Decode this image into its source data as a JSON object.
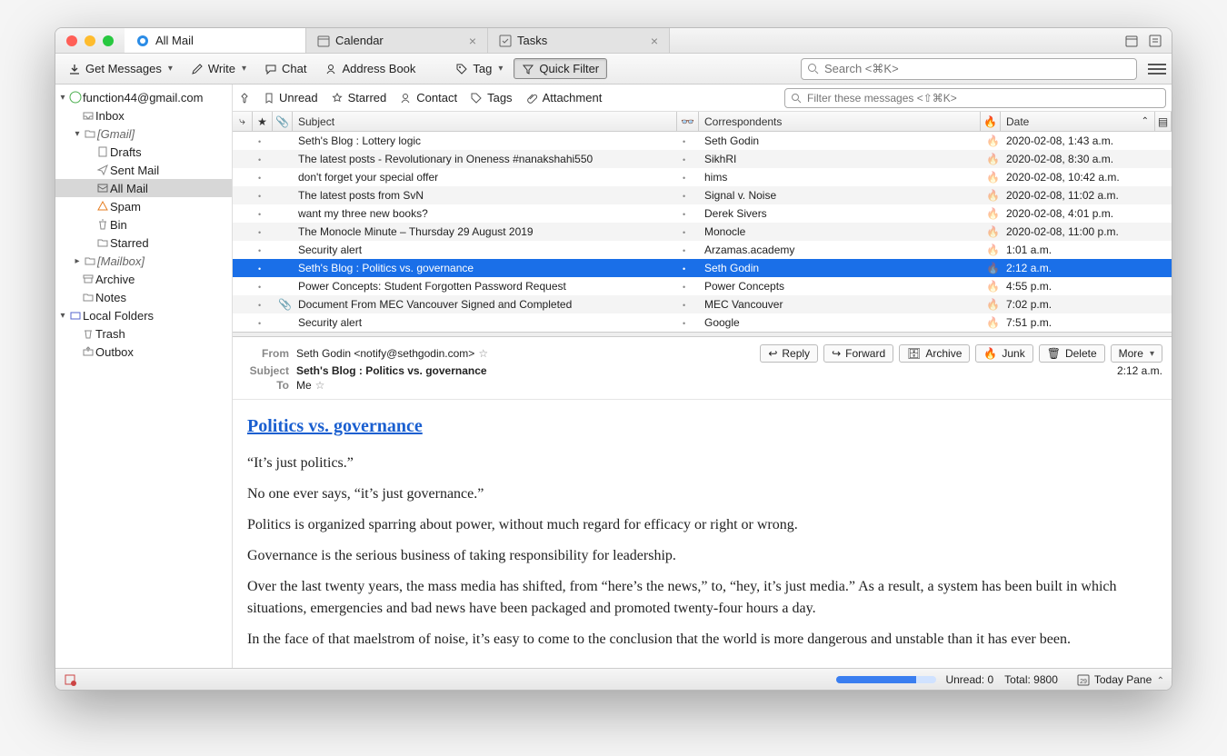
{
  "tabs": [
    {
      "label": "All Mail",
      "active": true,
      "icon": "thunderbird"
    },
    {
      "label": "Calendar",
      "active": false,
      "icon": "calendar",
      "closable": true
    },
    {
      "label": "Tasks",
      "active": false,
      "icon": "tasks",
      "closable": true
    }
  ],
  "toolbar": {
    "get_messages": "Get Messages",
    "write": "Write",
    "chat": "Chat",
    "address_book": "Address Book",
    "tag": "Tag",
    "quick_filter": "Quick Filter",
    "search_placeholder": "Search <⌘K>"
  },
  "sidebar": {
    "account": "function44@gmail.com",
    "inbox": "Inbox",
    "gmail": "[Gmail]",
    "drafts": "Drafts",
    "sent": "Sent Mail",
    "all_mail": "All Mail",
    "spam": "Spam",
    "bin": "Bin",
    "starred": "Starred",
    "mailbox": "[Mailbox]",
    "archive": "Archive",
    "notes": "Notes",
    "local_folders": "Local Folders",
    "trash": "Trash",
    "outbox": "Outbox"
  },
  "filterbar": {
    "unread": "Unread",
    "starred": "Starred",
    "contact": "Contact",
    "tags": "Tags",
    "attachment": "Attachment",
    "filter_placeholder": "Filter these messages <⇧⌘K>"
  },
  "columns": {
    "subject": "Subject",
    "correspondents": "Correspondents",
    "date": "Date"
  },
  "messages": [
    {
      "subject": "Seth's Blog : Lottery logic",
      "from": "Seth Godin",
      "date": "2020-02-08, 1:43 a.m."
    },
    {
      "subject": "The latest posts - Revolutionary in Oneness #nanakshahi550",
      "from": "SikhRI",
      "date": "2020-02-08, 8:30 a.m."
    },
    {
      "subject": "don't forget your special offer",
      "from": "hims",
      "date": "2020-02-08, 10:42 a.m."
    },
    {
      "subject": "The latest posts from SvN",
      "from": "Signal v. Noise",
      "date": "2020-02-08, 11:02 a.m."
    },
    {
      "subject": "want my three new books?",
      "from": "Derek Sivers",
      "date": "2020-02-08, 4:01 p.m."
    },
    {
      "subject": "The Monocle Minute – Thursday 29 August 2019",
      "from": "Monocle",
      "date": "2020-02-08, 11:00 p.m."
    },
    {
      "subject": "Security alert",
      "from": "Arzamas.academy",
      "date": "1:01 a.m."
    },
    {
      "subject": "Seth's Blog : Politics vs. governance",
      "from": "Seth Godin",
      "date": "2:12 a.m.",
      "selected": true
    },
    {
      "subject": "Power Concepts: Student Forgotten Password Request",
      "from": "Power Concepts",
      "date": "4:55 p.m."
    },
    {
      "subject": "Document From MEC Vancouver Signed and Completed",
      "from": "MEC Vancouver",
      "date": "7:02 p.m.",
      "attachment": true
    },
    {
      "subject": "Security alert",
      "from": "Google",
      "date": "7:51 p.m."
    }
  ],
  "reader": {
    "from_label": "From",
    "from_value": "Seth Godin <notify@sethgodin.com>",
    "subject_label": "Subject",
    "subject_value": "Seth's Blog : Politics vs. governance",
    "to_label": "To",
    "to_value": "Me",
    "time": "2:12 a.m.",
    "reply": "Reply",
    "forward": "Forward",
    "archive": "Archive",
    "junk": "Junk",
    "delete": "Delete",
    "more": "More",
    "title": "Politics vs. governance",
    "p1": "“It’s just politics.”",
    "p2": "No one ever says, “it’s just governance.”",
    "p3": "Politics is organized sparring about power, without much regard for efficacy or right or wrong.",
    "p4": "Governance is the serious business of taking responsibility for leadership.",
    "p5": "Over the last twenty years, the mass media has shifted, from “here’s the news,” to, “hey, it’s just media.” As a result, a system has been built in which situations, emergencies and bad news have been packaged and promoted twenty-four hours a day.",
    "p6": "In the face of that maelstrom of noise, it’s easy to come to the conclusion that the world is more dangerous and unstable than it has ever been."
  },
  "status": {
    "unread": "Unread: 0",
    "total": "Total: 9800",
    "today_pane": "Today Pane"
  }
}
